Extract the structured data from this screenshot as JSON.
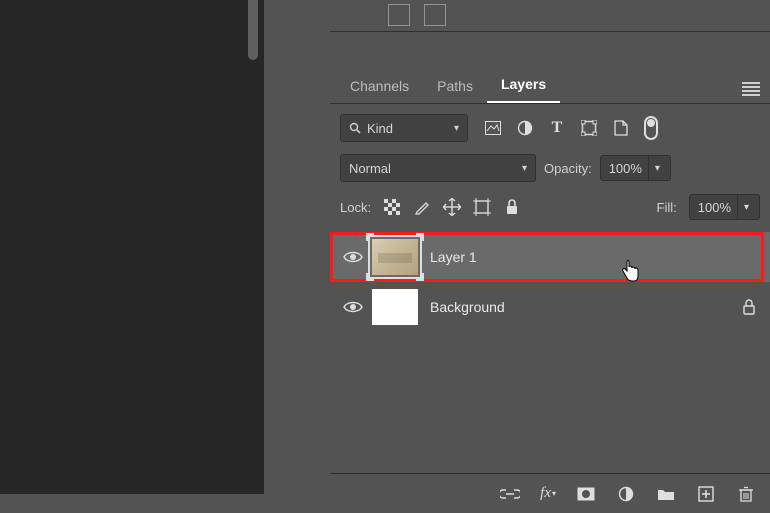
{
  "tabs": {
    "channels": "Channels",
    "paths": "Paths",
    "layers": "Layers"
  },
  "filter": {
    "kind_label": "Kind"
  },
  "blend": {
    "mode": "Normal",
    "opacity_label": "Opacity:",
    "opacity_value": "100%"
  },
  "lock": {
    "label": "Lock:",
    "fill_label": "Fill:",
    "fill_value": "100%"
  },
  "layers": [
    {
      "name": "Layer 1"
    },
    {
      "name": "Background"
    }
  ]
}
